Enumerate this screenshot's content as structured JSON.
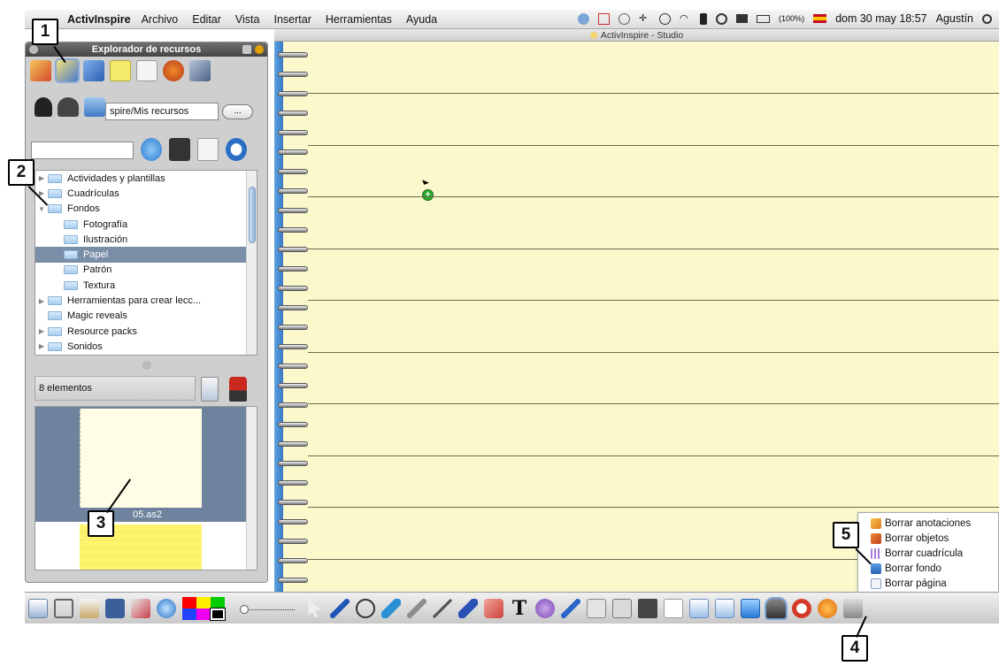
{
  "menubar": {
    "app_name": "ActivInspire",
    "menus": [
      "Archivo",
      "Editar",
      "Vista",
      "Insertar",
      "Herramientas",
      "Ayuda"
    ],
    "battery": "(100%)",
    "datetime": "dom 30 may 18:57",
    "user": "Agustín"
  },
  "window": {
    "title": "ActivInspire - Studio"
  },
  "panel": {
    "title": "Explorador de recursos",
    "path": "spire/Mis recursos",
    "more_label": "...",
    "search_placeholder": "",
    "tree": [
      {
        "label": "Actividades y plantillas",
        "expander": "collapsed",
        "level": 0
      },
      {
        "label": "Cuadrículas",
        "expander": "collapsed",
        "level": 0
      },
      {
        "label": "Fondos",
        "expander": "expanded",
        "level": 0
      },
      {
        "label": "Fotografía",
        "expander": "none",
        "level": 1
      },
      {
        "label": "Ilustración",
        "expander": "none",
        "level": 1
      },
      {
        "label": "Papel",
        "expander": "none",
        "level": 1,
        "selected": true
      },
      {
        "label": "Patrón",
        "expander": "none",
        "level": 1
      },
      {
        "label": "Textura",
        "expander": "none",
        "level": 1
      },
      {
        "label": "Herramientas para crear lecc...",
        "expander": "collapsed",
        "level": 0
      },
      {
        "label": "Magic reveals",
        "expander": "none",
        "level": 0
      },
      {
        "label": "Resource packs",
        "expander": "collapsed",
        "level": 0
      },
      {
        "label": "Sonidos",
        "expander": "collapsed",
        "level": 0
      }
    ],
    "count": "8 elementos",
    "thumb_filename": "05.as2"
  },
  "context_menu": {
    "items": [
      "Borrar anotaciones",
      "Borrar objetos",
      "Borrar cuadrícula",
      "Borrar fondo",
      "Borrar página"
    ],
    "highlighted": "Borrar fondo"
  },
  "callouts": [
    "1",
    "2",
    "3",
    "4",
    "5"
  ],
  "colors": {
    "page": "#fbf8cc",
    "spine": "#3a78c6",
    "selection": "#7b8ea8",
    "palette": [
      "#ff0000",
      "#ffee00",
      "#00cc00",
      "#2244ff",
      "#ee00ee",
      "#000000"
    ]
  }
}
